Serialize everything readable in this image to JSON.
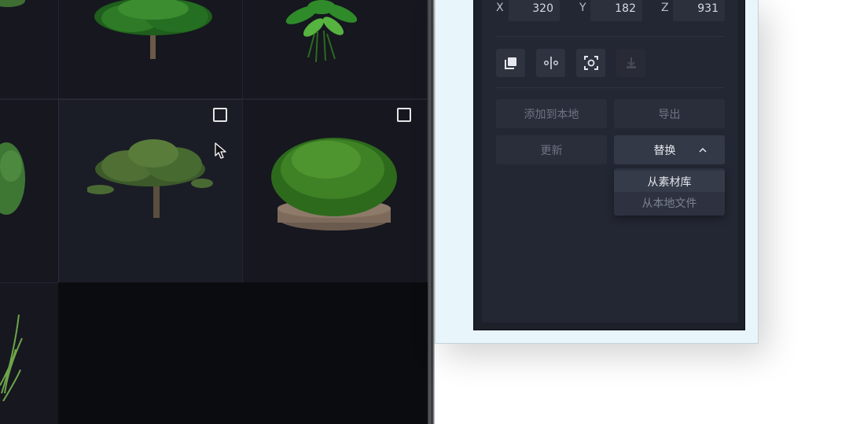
{
  "coords": {
    "x_label": "X",
    "x_value": "320",
    "y_label": "Y",
    "y_value": "182",
    "z_label": "Z",
    "z_value": "931"
  },
  "toolbar": {
    "icons": [
      "layers-icon",
      "align-center-icon",
      "focus-frame-icon",
      "ground-align-icon"
    ]
  },
  "actions": {
    "add_local": "添加到本地",
    "export": "导出",
    "update": "更新",
    "replace": "替换"
  },
  "replace_menu": {
    "items": [
      "从素材库",
      "从本地文件"
    ]
  },
  "colors": {
    "gallery_bg": "#0b0c10",
    "panel_bg": "#232733",
    "window_bg": "#e8f5fb"
  }
}
